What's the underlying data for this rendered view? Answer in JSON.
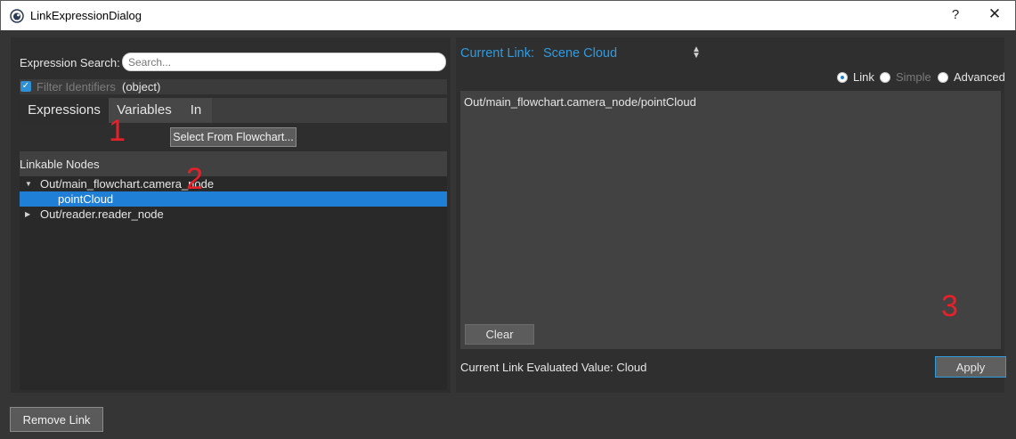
{
  "window": {
    "title": "LinkExpressionDialog",
    "help_label": "?",
    "close_label": "✕",
    "app_icon": "eye-icon"
  },
  "left_panel": {
    "search_label": "Expression Search:",
    "search_placeholder": "Search...",
    "search_value": "",
    "filter_label": "Filter Identifiers",
    "filter_checked": true,
    "object_label": "(object)",
    "tabs": [
      {
        "label": "Expressions",
        "active": true
      },
      {
        "label": "Variables",
        "active": false
      },
      {
        "label": "In",
        "active": false
      }
    ],
    "select_flowchart_label": "Select From Flowchart...",
    "tree_header": "Linkable Nodes",
    "tree": [
      {
        "label": "Out/main_flowchart.camera_node",
        "expanded": true
      },
      {
        "label": "pointCloud",
        "selected": true
      },
      {
        "label": "Out/reader.reader_node",
        "expanded": false
      }
    ]
  },
  "annotations": [
    "1",
    "2",
    "3"
  ],
  "right_panel": {
    "current_link_label": "Current Link:",
    "current_link_value": "Scene Cloud",
    "radio_options": [
      {
        "label": "Link",
        "checked": true,
        "enabled": true
      },
      {
        "label": "Simple",
        "checked": false,
        "enabled": false
      },
      {
        "label": "Advanced",
        "checked": false,
        "enabled": true
      }
    ],
    "expression_text": "Out/main_flowchart.camera_node/pointCloud",
    "clear_label": "Clear",
    "evaluated_label": "Current Link Evaluated Value: Cloud",
    "apply_label": "Apply"
  },
  "footer": {
    "remove_link_label": "Remove Link"
  },
  "colors": {
    "accent": "#2f9be0",
    "selection": "#1f7fd6",
    "annotation": "#e8202a"
  }
}
